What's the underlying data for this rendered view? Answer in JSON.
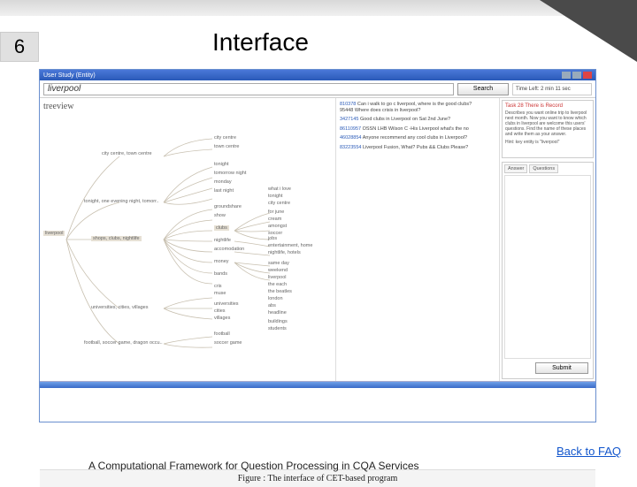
{
  "slide": {
    "number": "6",
    "title": "Interface",
    "footer": "A Computational Framework for Question Processing in CQA Services",
    "back_link": "Back to FAQ"
  },
  "window": {
    "title": "User Study (Entity)",
    "search_value": "liverpool",
    "search_button": "Search",
    "time_left": "Time Left: 2 min 11 sec",
    "submit_button": "Submit",
    "caption": "Figure : The interface of CET-based program"
  },
  "tree": {
    "view_label": "treeview",
    "root": "liverpool",
    "level1": [
      "city centre, town centre",
      "tonight, one evening night, tomorr..",
      "shops, clubs, nightlife",
      "universities, cities, villages",
      "football, soccer game, dragon occu.."
    ],
    "level2": [
      "city centre",
      "town centre",
      "tonight",
      "tomorrow night",
      "monday",
      "last night",
      "what i love",
      "tonight",
      "city centre",
      "groundshare",
      "show",
      "clubs",
      "nightlife",
      "accomodation",
      "money",
      "bands",
      "cris",
      "muse",
      "universities",
      "cities",
      "villages",
      "football",
      "soccer game"
    ],
    "level3": [
      "for june",
      "cream",
      "amongst",
      "soccer",
      "jobs",
      "entertainment, home",
      "nightlife, hotels",
      "same day",
      "weekend",
      "liverpool",
      "the each",
      "the beatles",
      "london",
      "abs",
      "headline",
      "buildings",
      "students"
    ]
  },
  "results": [
    {
      "id": "810378",
      "text": "Can i walk to go c liverpool, where is the good clubs?",
      "sub": "95448 Where does crisis in liverpool?"
    },
    {
      "id": "3427145",
      "text": "Good clubs in Liverpool on Sat 2nd June?"
    },
    {
      "id": "86110957",
      "text": "OSSN LHB Wilson C -His Liverpool what's the no"
    },
    {
      "id": "46028854",
      "text": "Anyone recommend any cool clubs in Liverpool?"
    },
    {
      "id": "83223554",
      "text": "Liverpool Fusion, What? Pubs && Clubs Please?"
    }
  ],
  "task": {
    "title": "Task 28 There is Record",
    "desc": "Describes you want online trip to liverpool next month. Now you want to know which clubs in liverpool are welcome this users' questions. Find the name of these places and write them as your answer.",
    "hint": "Hint: key entity is \"liverpool\"",
    "tab_answer": "Answer",
    "tab_questions": "Questions"
  }
}
